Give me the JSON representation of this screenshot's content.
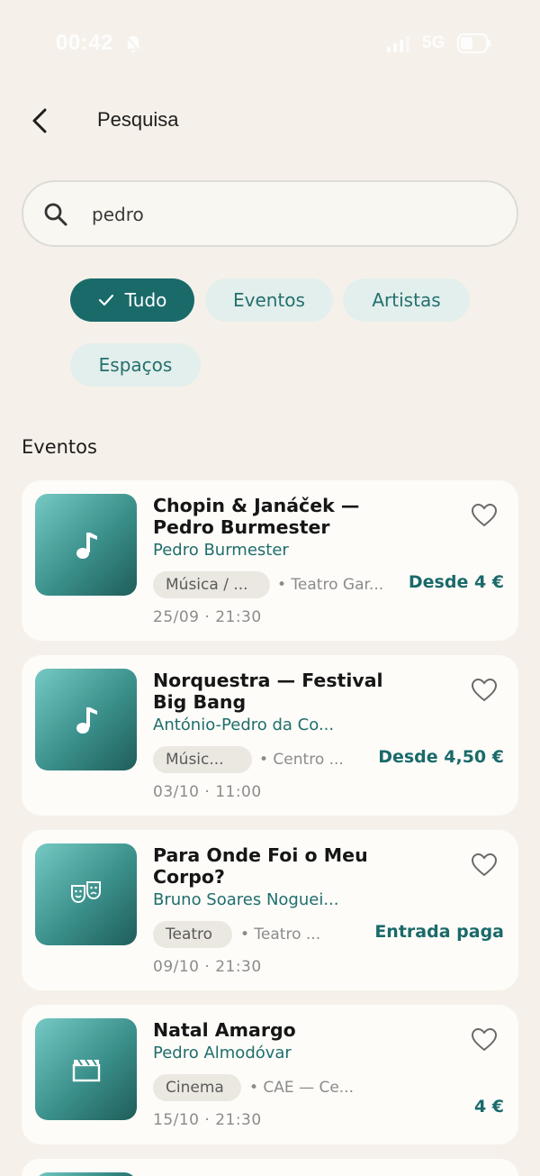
{
  "status_bar": {
    "time": "00:42",
    "network": "5G",
    "battery": "49"
  },
  "header": {
    "title": "Pesquisa"
  },
  "search": {
    "value": "pedro",
    "placeholder": ""
  },
  "filters": [
    {
      "label": "Tudo",
      "active": true
    },
    {
      "label": "Eventos",
      "active": false
    },
    {
      "label": "Artistas",
      "active": false
    },
    {
      "label": "Espaços",
      "active": false
    }
  ],
  "section": {
    "title": "Eventos"
  },
  "events": [
    {
      "title": "Chopin & Janáček — Pedro Burmester",
      "artist": "Pedro Burmester",
      "category": "Música / ...",
      "venue": "• Teatro Gar...",
      "price": "Desde 4 €",
      "date": "25/09 · 21:30",
      "icon": "music-note-icon"
    },
    {
      "title": "Norquestra — Festival Big Bang",
      "artist": "António-Pedro da Co...",
      "category": "Músic...",
      "venue": "• Centro ...",
      "price": "Desde 4,50 €",
      "date": "03/10 · 11:00",
      "icon": "music-note-icon"
    },
    {
      "title": "Para Onde Foi o Meu Corpo?",
      "artist": "Bruno Soares Noguei...",
      "category": "Teatro",
      "venue": "• Teatro ...",
      "price": "Entrada paga",
      "date": "09/10 · 21:30",
      "icon": "theater-masks-icon"
    },
    {
      "title": "Natal Amargo",
      "artist": "Pedro Almodóvar",
      "category": "Cinema",
      "venue": "• CAE — Ce...",
      "price": "4 €",
      "date": "15/10 · 21:30",
      "icon": "film-clapper-icon"
    }
  ],
  "colors": {
    "accent": "#1a6a6a",
    "background": "#f5f1ea",
    "chip": "#e3efec"
  }
}
